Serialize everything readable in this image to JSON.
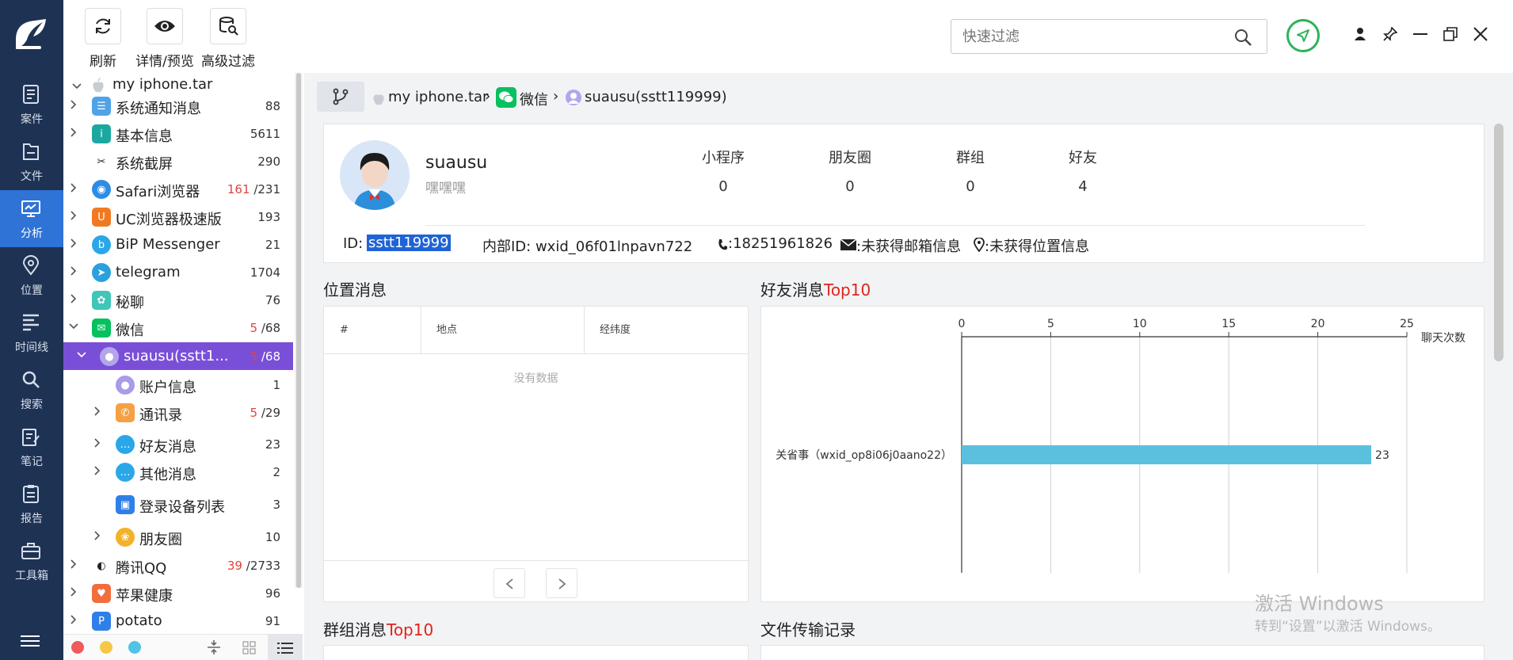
{
  "nav": {
    "items": [
      {
        "label": "案件",
        "icon": "case-icon"
      },
      {
        "label": "文件",
        "icon": "file-icon"
      },
      {
        "label": "分析",
        "icon": "analysis-icon"
      },
      {
        "label": "位置",
        "icon": "location-icon"
      },
      {
        "label": "时间线",
        "icon": "timeline-icon"
      },
      {
        "label": "搜索",
        "icon": "search-icon"
      },
      {
        "label": "笔记",
        "icon": "note-icon"
      },
      {
        "label": "报告",
        "icon": "report-icon"
      },
      {
        "label": "工具箱",
        "icon": "toolbox-icon"
      }
    ],
    "active_index": 2
  },
  "toolbar": {
    "refresh": "刷新",
    "details": "详情/预览",
    "advanced": "高级过滤"
  },
  "search": {
    "placeholder": "快速过滤"
  },
  "tree": {
    "root": "my iphone.tar",
    "items": [
      {
        "name": "系统通知消息",
        "count": "88"
      },
      {
        "name": "基本信息",
        "count": "5611"
      },
      {
        "name": "系统截屏",
        "count": "290"
      },
      {
        "name": "Safari浏览器",
        "count_red": "161",
        "count": "/231"
      },
      {
        "name": "UC浏览器极速版",
        "count": "193"
      },
      {
        "name": "BiP Messenger",
        "count": "21"
      },
      {
        "name": "telegram",
        "count": "1704"
      },
      {
        "name": "秘聊",
        "count": "76"
      },
      {
        "name": "微信",
        "count_red": "5",
        "count": "/68"
      },
      {
        "name": "suausu(sstt1...",
        "count_red": "5",
        "count": "/68"
      },
      {
        "name": "账户信息",
        "count": "1"
      },
      {
        "name": "通讯录",
        "count_red": "5",
        "count": "/29"
      },
      {
        "name": "好友消息",
        "count": "23"
      },
      {
        "name": "其他消息",
        "count": "2"
      },
      {
        "name": "登录设备列表",
        "count": "3"
      },
      {
        "name": "朋友圈",
        "count": "10"
      },
      {
        "name": "腾讯QQ",
        "count_red": "39",
        "count": "/2733"
      },
      {
        "name": "苹果健康",
        "count": "96"
      },
      {
        "name": "potato",
        "count": "91"
      }
    ]
  },
  "breadcrumb": {
    "root": "my iphone.tar",
    "app": "微信",
    "account": "suausu(sstt119999)"
  },
  "profile": {
    "name": "suausu",
    "signature": "嘿嘿嘿",
    "id_label": "ID:",
    "id_value": "sstt119999",
    "internal_id": "内部ID: wxid_06f01lnpavn722",
    "phone": ":18251961826",
    "email": ":未获得邮箱信息",
    "location": ":未获得位置信息",
    "stats": [
      {
        "label": "小程序",
        "value": "0"
      },
      {
        "label": "朋友圈",
        "value": "0"
      },
      {
        "label": "群组",
        "value": "0"
      },
      {
        "label": "好友",
        "value": "4"
      }
    ]
  },
  "location_section": {
    "title": "位置消息",
    "columns": [
      "#",
      "地点",
      "经纬度"
    ],
    "empty_text": "没有数据"
  },
  "friend_section": {
    "title_prefix": "好友消息",
    "title_highlight": "Top10"
  },
  "group_section": {
    "title_prefix": "群组消息",
    "title_highlight": "Top10"
  },
  "file_section": {
    "title": "文件传输记录"
  },
  "watermark": {
    "line1": "激活 Windows",
    "line2": "转到“设置”以激活 Windows。"
  },
  "colors": {
    "nav_bg": "#1e3254",
    "nav_active": "#2f73d6",
    "tree_selected": "#7a4fd8",
    "bar": "#5bc0de",
    "highlight_red": "#e0241b",
    "send_green": "#2db35a"
  },
  "chart_data": {
    "type": "bar",
    "orientation": "horizontal",
    "categories": [
      "关省事（wxid_op8i06j0aano22）"
    ],
    "values": [
      23
    ],
    "xlabel": "聊天次数",
    "xlim": [
      0,
      25
    ],
    "xticks": [
      0,
      5,
      10,
      15,
      20,
      25
    ],
    "grid": true,
    "axis_position": "top"
  }
}
